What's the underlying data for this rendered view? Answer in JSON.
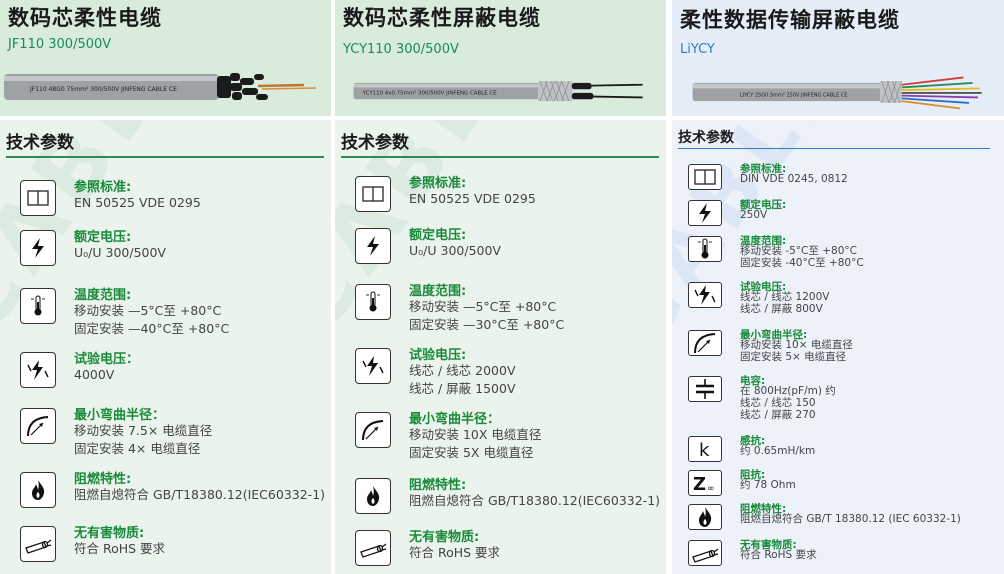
{
  "panels": [
    {
      "title": "数码芯柔性电缆",
      "model": "JF110 300/500V",
      "cable_print": "JF110 48G0.75mm² 300/500V JINFENG CABLE CE",
      "tech_title": "技术参数",
      "specs": [
        {
          "icon": "book-icon",
          "label": "参照标准:",
          "values": [
            "EN 50525  VDE 0295"
          ]
        },
        {
          "icon": "lightning-icon",
          "label": "额定电压:",
          "values": [
            "U₀/U 300/500V"
          ]
        },
        {
          "icon": "thermometer-icon",
          "label": "温度范围:",
          "values": [
            "移动安装  —5°C至 +80°C",
            "固定安装  —40°C至 +80°C"
          ]
        },
        {
          "icon": "test-voltage-icon",
          "label": "试验电压：",
          "values": [
            "4000V"
          ]
        },
        {
          "icon": "bend-radius-icon",
          "label": "最小弯曲半径：",
          "values": [
            "移动安装   7.5× 电缆直径",
            "固定安装   4×  电缆直径"
          ]
        },
        {
          "icon": "flame-icon",
          "label": "阻燃特性:",
          "values": [
            "阻燃自熄符合 GB/T18380.12(IEC60332-1)"
          ]
        },
        {
          "icon": "cable-icon",
          "label": "无有害物质:",
          "values": [
            "符合 RoHS 要求"
          ]
        }
      ]
    },
    {
      "title": "数码芯柔性屏蔽电缆",
      "model": "YCY110 300/500V",
      "cable_print": "YCY110 4x0.75mm²  300/500V JINFENG CABLE CE",
      "tech_title": "技术参数",
      "specs": [
        {
          "icon": "book-icon",
          "label": "参照标准:",
          "values": [
            "EN 50525  VDE 0295"
          ]
        },
        {
          "icon": "lightning-icon",
          "label": "额定电压:",
          "values": [
            "U₀/U 300/500V"
          ]
        },
        {
          "icon": "thermometer-icon",
          "label": "温度范围:",
          "values": [
            "移动安装  —5°C至 +80°C",
            "固定安装  —30°C至 +80°C"
          ]
        },
        {
          "icon": "test-voltage-icon",
          "label": "试验电压:",
          "values": [
            "线芯 / 线芯 2000V",
            "线芯 / 屏蔽 1500V"
          ]
        },
        {
          "icon": "bend-radius-icon",
          "label": "最小弯曲半径：",
          "values": [
            "移动安装 10X 电缆直径",
            "固定安装 5X 电缆直径"
          ]
        },
        {
          "icon": "flame-icon",
          "label": "阻燃特性:",
          "values": [
            "阻燃自熄符合 GB/T18380.12(IEC60332-1)"
          ]
        },
        {
          "icon": "cable-icon",
          "label": "无有害物质:",
          "values": [
            "符合 RoHS 要求"
          ]
        }
      ]
    },
    {
      "title": "柔性数据传输屏蔽电缆",
      "model": "LiYCY",
      "cable_print": "LIYCY 25G0.5mm²  250V  JINFENG CABLE CE",
      "tech_title": "技术参数",
      "specs": [
        {
          "icon": "book-icon",
          "label": "参照标准:",
          "values": [
            "DIN VDE 0245, 0812"
          ]
        },
        {
          "icon": "lightning-icon",
          "label": "额定电压:",
          "values": [
            "250V"
          ]
        },
        {
          "icon": "thermometer-icon",
          "label": "温度范围:",
          "values": [
            "移动安装 -5°C至 +80°C",
            "固定安装 -40°C至 +80°C"
          ]
        },
        {
          "icon": "test-voltage-icon",
          "label": "试验电压:",
          "values": [
            "线芯 / 线芯 1200V",
            "线芯 / 屏蔽 800V"
          ]
        },
        {
          "icon": "bend-radius-icon",
          "label": "最小弯曲半径:",
          "values": [
            "移动安装 10× 电缆直径",
            "固定安装  5×  电缆直径"
          ]
        },
        {
          "icon": "capacitor-icon",
          "label": "电容:",
          "values": [
            "在 800Hz(pF/m) 约",
            "线芯 / 线芯 150",
            "线芯 / 屏蔽 270"
          ]
        },
        {
          "icon": "inductance-icon",
          "label": "感抗:",
          "values": [
            "约 0.65mH/km"
          ]
        },
        {
          "icon": "impedance-icon",
          "label": "阻抗:",
          "values": [
            "约 78 Ohm"
          ]
        },
        {
          "icon": "flame-icon",
          "label": "阻燃特性:",
          "values": [
            "阻燃自熄符合 GB/T 18380.12 (IEC 60332-1)"
          ]
        },
        {
          "icon": "cable-icon",
          "label": "无有害物质:",
          "values": [
            "符合 RoHS 要求"
          ]
        }
      ]
    }
  ],
  "watermark_text": "CABLE",
  "colors": {
    "accent_green": "#1a8a3a",
    "line_green": "#2e8b57",
    "panel_bg_green": "#eaf3ec",
    "panel_bg_blue": "#edf2fa",
    "header_bg_green": "#d9ecdc",
    "header_bg_blue": "#e4edf8"
  }
}
